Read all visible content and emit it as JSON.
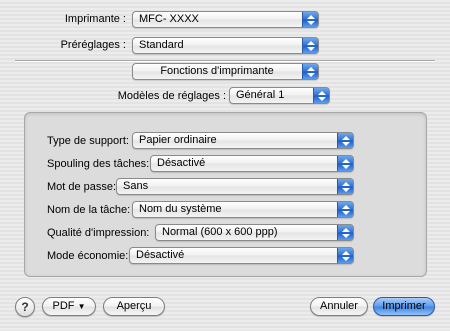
{
  "printer": {
    "label": "Imprimante :",
    "value": "MFC- XXXX"
  },
  "presets": {
    "label": "Préréglages :",
    "value": "Standard"
  },
  "section": {
    "value": "Fonctions d'imprimante"
  },
  "models": {
    "label": "Modèles de réglages :",
    "value": "Général 1"
  },
  "settings": [
    {
      "label": "Type de support:",
      "value": "Papier ordinaire"
    },
    {
      "label": "Spouling des tâches:",
      "value": "Désactivé"
    },
    {
      "label": "Mot de passe:",
      "value": "Sans"
    },
    {
      "label": "Nom de la tâche:",
      "value": "Nom du système"
    },
    {
      "label": "Qualité d'impression:",
      "value": "Normal (600 x 600 ppp)"
    },
    {
      "label": "Mode économie:",
      "value": "Désactivé"
    }
  ],
  "footer": {
    "help": "?",
    "pdf": "PDF",
    "pdf_arrow": "▼",
    "preview": "Aperçu",
    "cancel": "Annuler",
    "print": "Imprimer"
  }
}
